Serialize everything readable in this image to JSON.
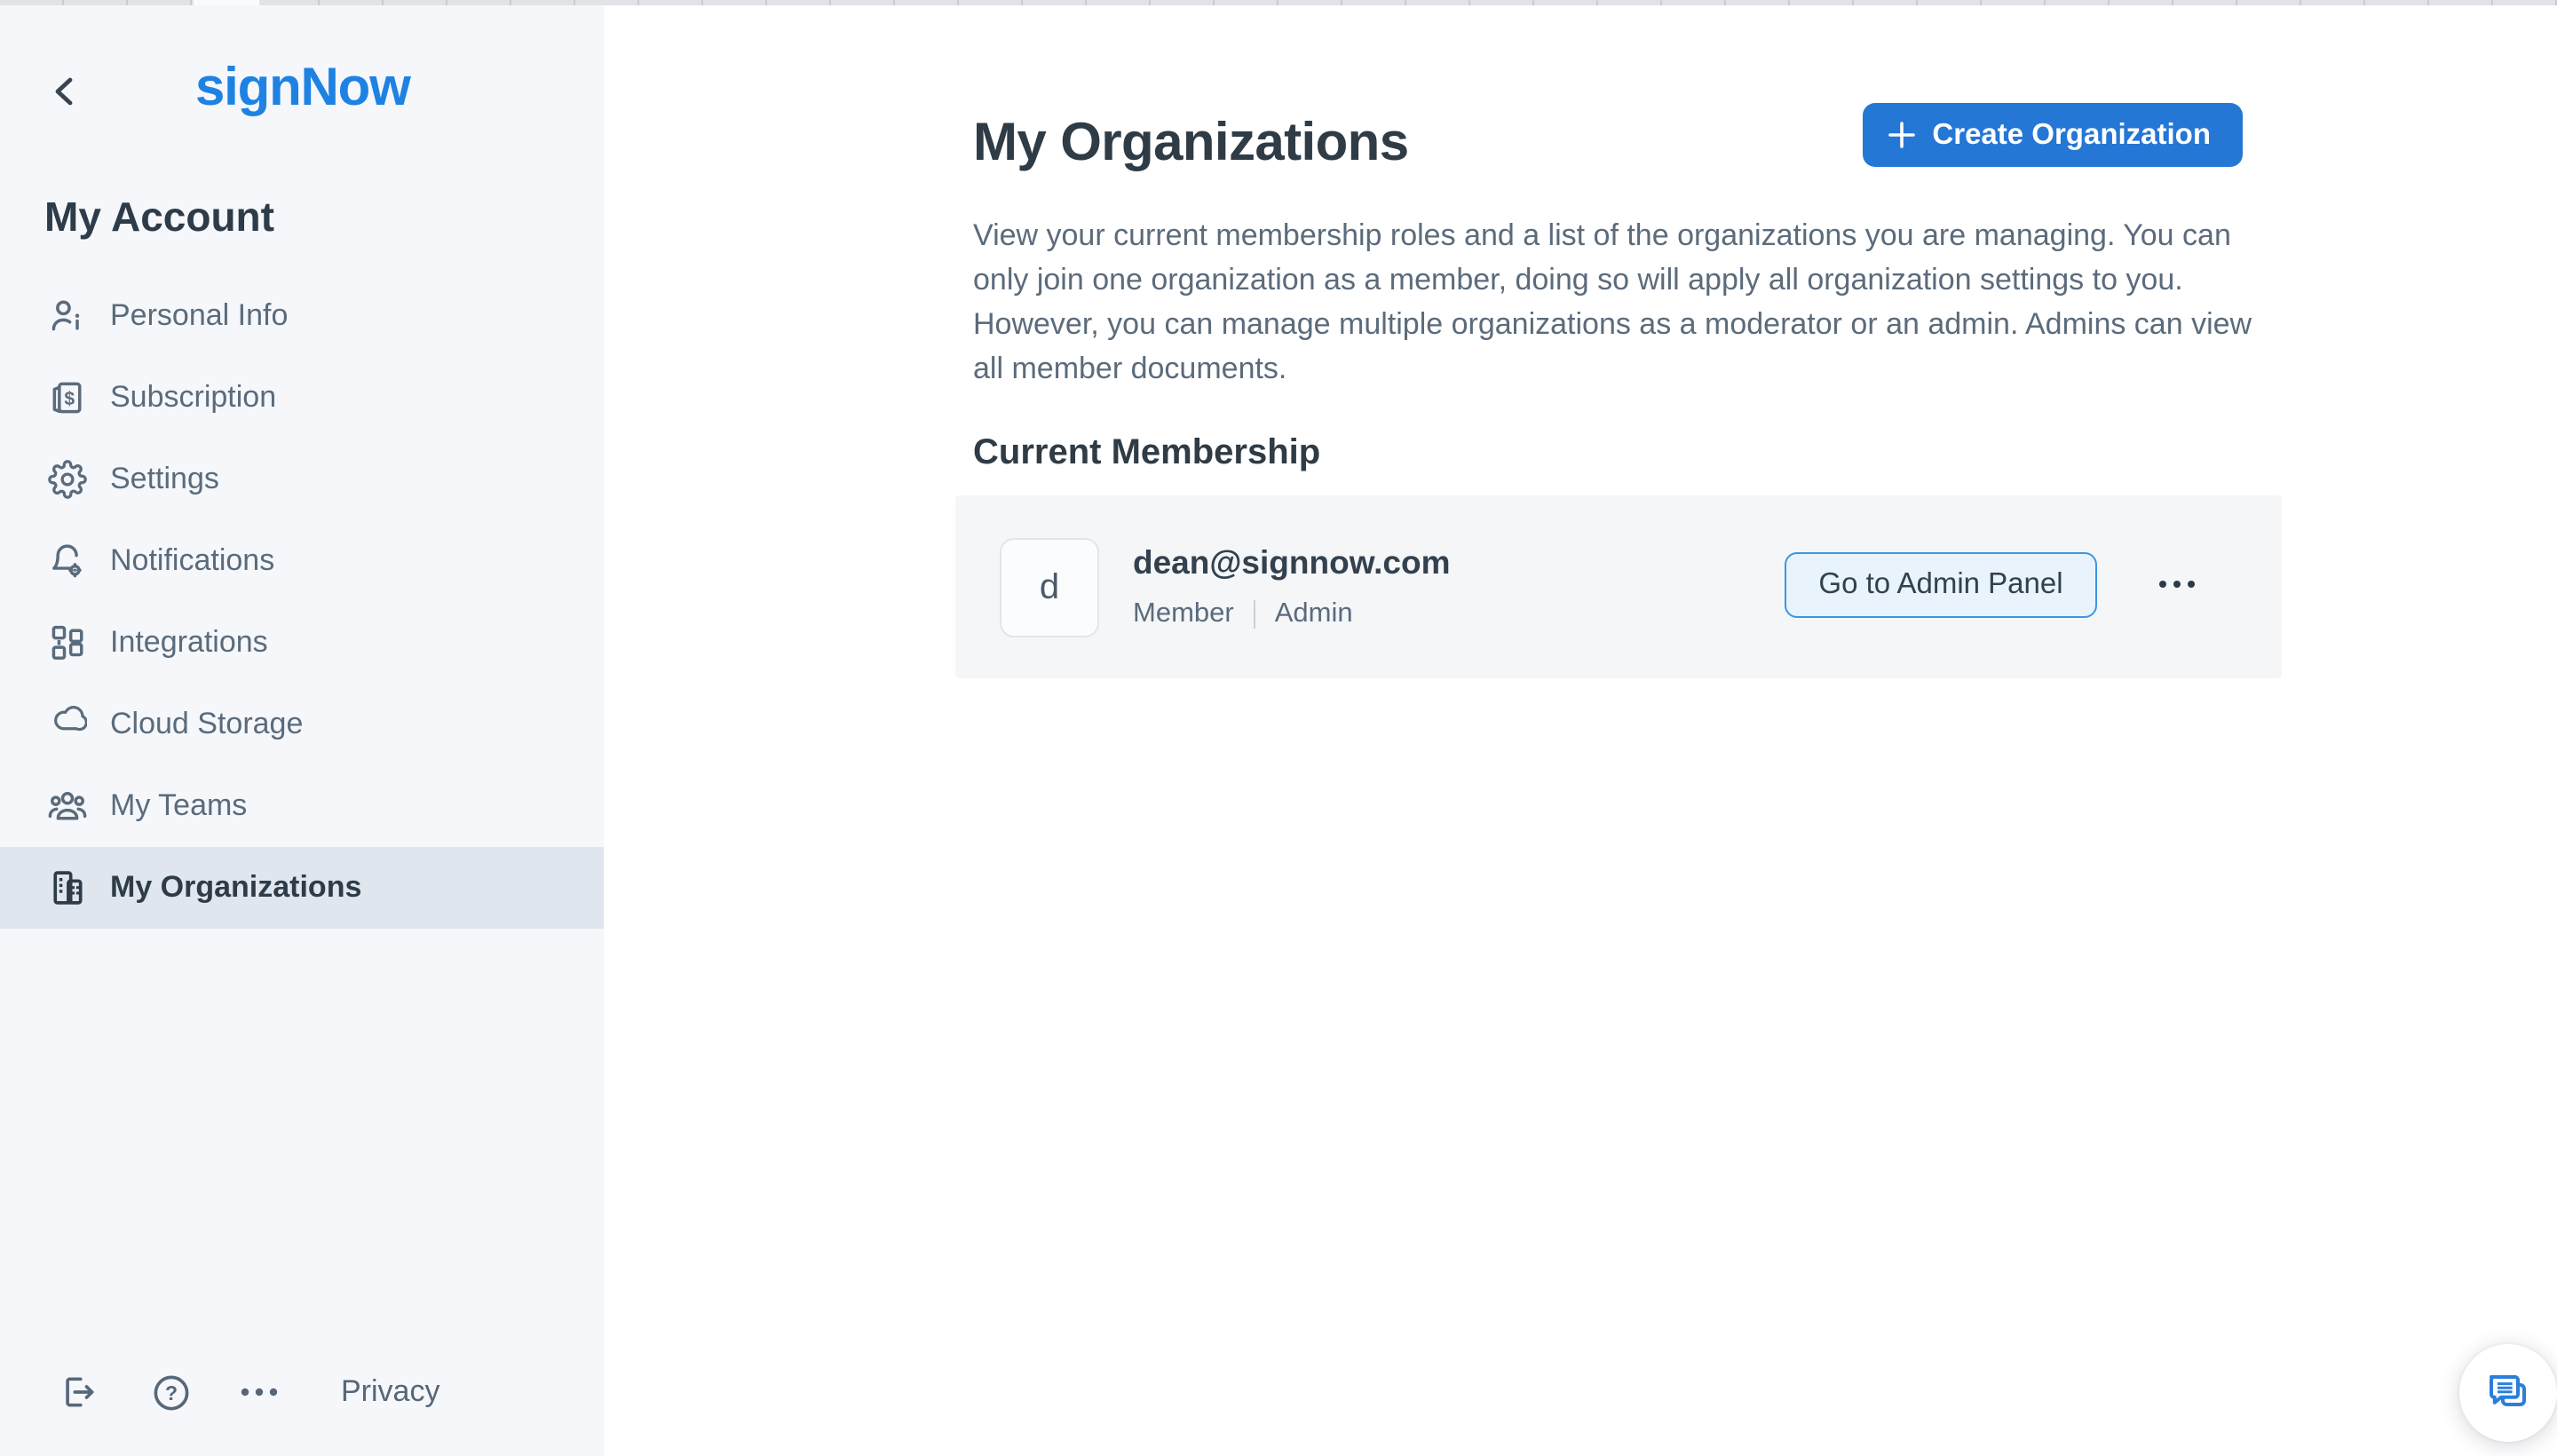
{
  "sidebar": {
    "logo": "signNow",
    "heading": "My Account",
    "items": [
      {
        "label": "Personal Info",
        "icon": "personal-info-icon"
      },
      {
        "label": "Subscription",
        "icon": "subscription-icon"
      },
      {
        "label": "Settings",
        "icon": "settings-icon"
      },
      {
        "label": "Notifications",
        "icon": "notifications-icon"
      },
      {
        "label": "Integrations",
        "icon": "integrations-icon"
      },
      {
        "label": "Cloud Storage",
        "icon": "cloud-storage-icon"
      },
      {
        "label": "My Teams",
        "icon": "my-teams-icon"
      },
      {
        "label": "My Organizations",
        "icon": "my-organizations-icon",
        "active": true
      }
    ],
    "footer": {
      "privacy_label": "Privacy",
      "icons": [
        "logout-icon",
        "help-icon",
        "more-icon"
      ]
    }
  },
  "main": {
    "title": "My Organizations",
    "create_button": {
      "label": "Create Organization",
      "icon": "plus-icon"
    },
    "description": "View your current membership roles and a list of the organizations you are managing. You can only join one organization as a member, doing so will apply all organization settings to you. However, you can manage multiple organizations as a moderator or an admin. Admins can view all member documents.",
    "section_heading": "Current Membership",
    "membership": {
      "avatar_letter": "d",
      "email": "dean@signnow.com",
      "roles": [
        "Member",
        "Admin"
      ],
      "action_label": "Go to Admin Panel",
      "more_icon": "ellipsis-icon"
    }
  },
  "floating": {
    "chat_icon": "chat-bubble-icon"
  },
  "colors": {
    "brand_blue": "#1e82e3",
    "button_blue": "#2577d6",
    "sidebar_bg": "#f5f7fa",
    "active_item_bg": "#e0e6ed",
    "card_bg": "#f4f6f8",
    "admin_btn_bg": "#e9f3fc",
    "admin_btn_border": "#3d95e2",
    "text_dark": "#2f3b45",
    "text_muted": "#5b6b7c"
  }
}
